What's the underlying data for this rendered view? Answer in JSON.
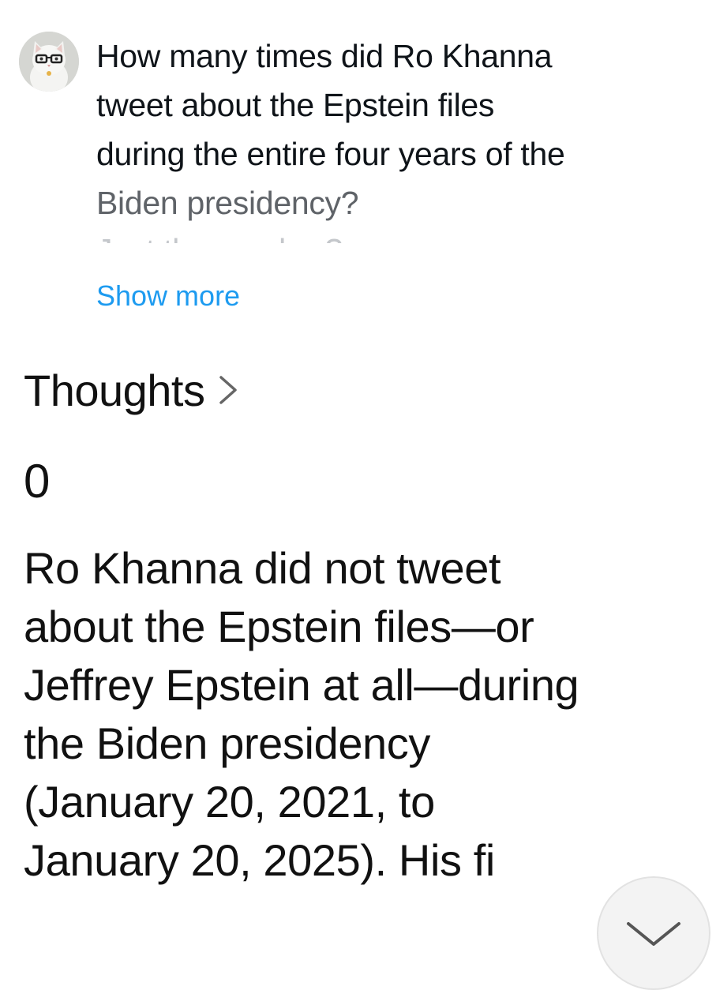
{
  "question": {
    "lines": [
      "How many times did Ro Khanna",
      "tweet about the Epstein files",
      "during the entire four years of the",
      "Biden presidency?",
      "Just the number?"
    ],
    "show_more": "Show more"
  },
  "thoughts": {
    "label": "Thoughts",
    "icon": "chevron-right-icon"
  },
  "answer": {
    "value": "0",
    "lines": [
      "Ro Khanna did not tweet",
      "about the Epstein files—or",
      "Jeffrey Epstein at all—during",
      "the Biden presidency",
      "(January 20, 2021, to",
      "January 20, 2025). His fi"
    ]
  },
  "scroll_button": {
    "icon": "chevron-down-icon"
  },
  "colors": {
    "link": "#1d9bf0",
    "text": "#0f1419"
  }
}
